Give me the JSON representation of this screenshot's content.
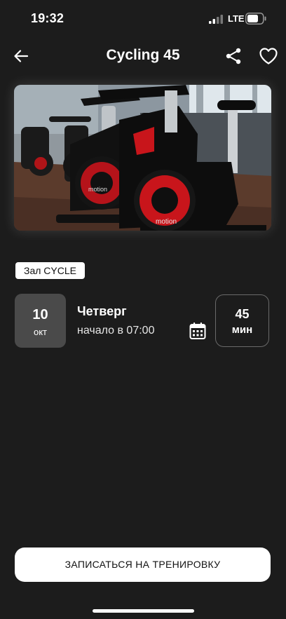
{
  "status_bar": {
    "time": "19:32",
    "network": "LTE"
  },
  "header": {
    "title": "Cycling 45"
  },
  "hero": {
    "bike_brand": "motion"
  },
  "hall": {
    "label": "Зал CYCLE"
  },
  "schedule": {
    "day": "10",
    "month": "окт",
    "weekday": "Четверг",
    "start_text": "начало в 07:00",
    "duration_value": "45",
    "duration_unit": "мин"
  },
  "cta": {
    "label": "ЗАПИСАТЬСЯ НА ТРЕНИРОВКУ"
  },
  "colors": {
    "background": "#1c1c1c",
    "date_box": "#4a4a4a",
    "bike_accent": "#c8151b"
  },
  "icons": [
    "back-arrow-icon",
    "share-icon",
    "heart-icon",
    "calendar-icon",
    "signal-icon",
    "battery-icon"
  ]
}
